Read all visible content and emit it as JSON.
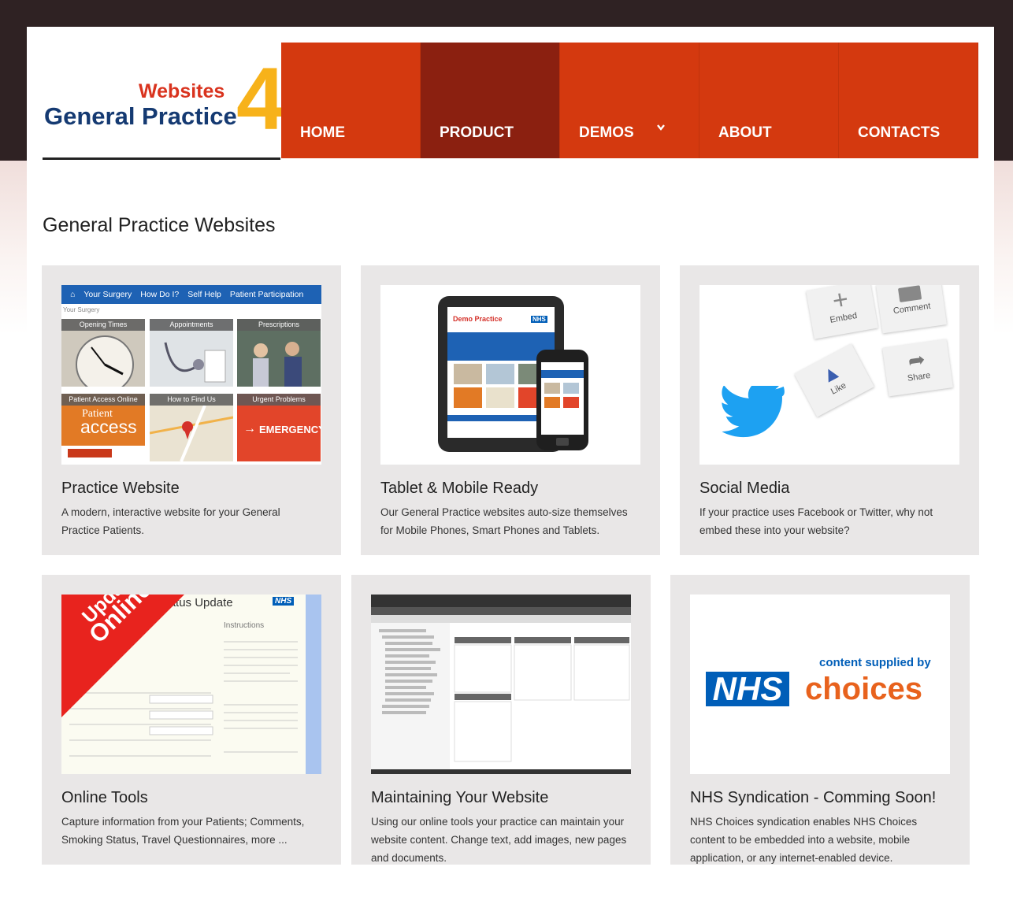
{
  "logo": {
    "websites": "Websites",
    "general_practice": "General Practice",
    "four": "4"
  },
  "nav": {
    "home": "HOME",
    "product": "PRODUCT",
    "demos": "DEMOS",
    "about": "ABOUT",
    "contacts": "CONTACTS",
    "chevron_icon": "chevron-down-icon"
  },
  "page_title": "General Practice Websites",
  "cards": [
    {
      "title": "Practice Website",
      "text": "A modern, interactive website for your General Practice Patients."
    },
    {
      "title": "Tablet & Mobile Ready",
      "text": "Our General Practice websites auto-size themselves for Mobile Phones, Smart Phones and Tablets."
    },
    {
      "title": "Social Media",
      "text": "If your practice uses Facebook or Twitter, why not embed these into your website?"
    },
    {
      "title": "Online Tools",
      "text": "Capture information from your Patients; Comments, Smoking Status, Travel Questionnaires, more ..."
    },
    {
      "title": "Maintaining Your Website",
      "text": "Using our online tools your practice can maintain your website content. Change text, add images, new pages and documents."
    },
    {
      "title": "NHS Syndication - Comming Soon!",
      "text": "NHS Choices syndication enables NHS Choices content to be embedded into a website, mobile application, or any internet-enabled device."
    }
  ],
  "thumb1": {
    "nav": [
      "Your Surgery",
      "How Do I?",
      "Self Help",
      "Patient Participation"
    ],
    "breadcrumb": "Your Surgery",
    "tiles": [
      "Opening Times",
      "Appointments",
      "Prescriptions",
      "Patient Access Online",
      "How to Find Us",
      "Urgent Problems"
    ],
    "patient": "Patient",
    "access": "access",
    "emergency": "EMERGENCY"
  },
  "thumb2": {
    "demo": "Demo Practice",
    "nhs": "NHS"
  },
  "thumb3": {
    "embed": "Embed",
    "comment": "Comment",
    "like": "Like",
    "share": "Share"
  },
  "thumb4": {
    "heading": "Smoking Status Update",
    "ribbon1": "Update",
    "ribbon2": "Online",
    "nhs": "NHS",
    "instructions": "Instructions"
  },
  "thumb6": {
    "supplied": "content supplied by",
    "nhs": "NHS",
    "choices": "choices"
  },
  "colors": {
    "nav": "#d4390f",
    "nav_active": "#8b2010",
    "logo_blue": "#153a72",
    "logo_red": "#d9331e",
    "logo_gold": "#f7b21a",
    "nhs_blue": "#005eb8",
    "choices_orange": "#e8621d"
  }
}
